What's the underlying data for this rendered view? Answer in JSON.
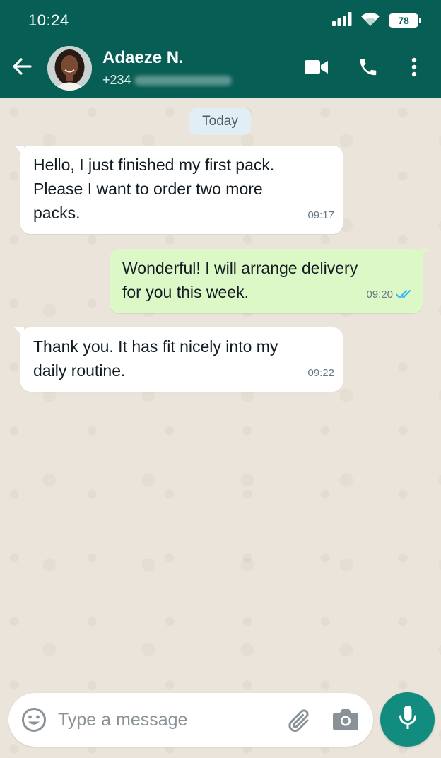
{
  "status_bar": {
    "time": "10:24",
    "battery": "78",
    "icons": [
      "signal-icon",
      "wifi-icon",
      "battery-icon"
    ]
  },
  "header": {
    "contact_name": "Adaeze N.",
    "contact_phone": "+234",
    "icons": [
      "back-arrow-icon",
      "video-call-icon",
      "phone-icon",
      "more-vert-icon"
    ]
  },
  "chat": {
    "date_separator": "Today",
    "messages": [
      {
        "direction": "incoming",
        "text": "Hello, I just finished my first pack.\nPlease I want to order two more\npacks.",
        "time": "09:17"
      },
      {
        "direction": "outgoing",
        "text": "Wonderful! I will arrange delivery\nfor you this week.",
        "time": "09:20",
        "status": "read",
        "status_icon": "double-check-icon"
      },
      {
        "direction": "incoming",
        "text": "Thank you. It has fit nicely into my\ndaily routine.",
        "time": "09:22"
      }
    ]
  },
  "composer": {
    "placeholder": "Type a message",
    "value": "",
    "icons": [
      "emoji-icon",
      "attach-icon",
      "camera-icon",
      "mic-icon"
    ]
  },
  "colors": {
    "header": "#075e54",
    "outgoing_bubble": "#dcf8c6",
    "incoming_bubble": "#ffffff",
    "chat_background": "#ebe4da",
    "mic_button": "#128c7e",
    "read_ticks": "#34b7f1"
  }
}
